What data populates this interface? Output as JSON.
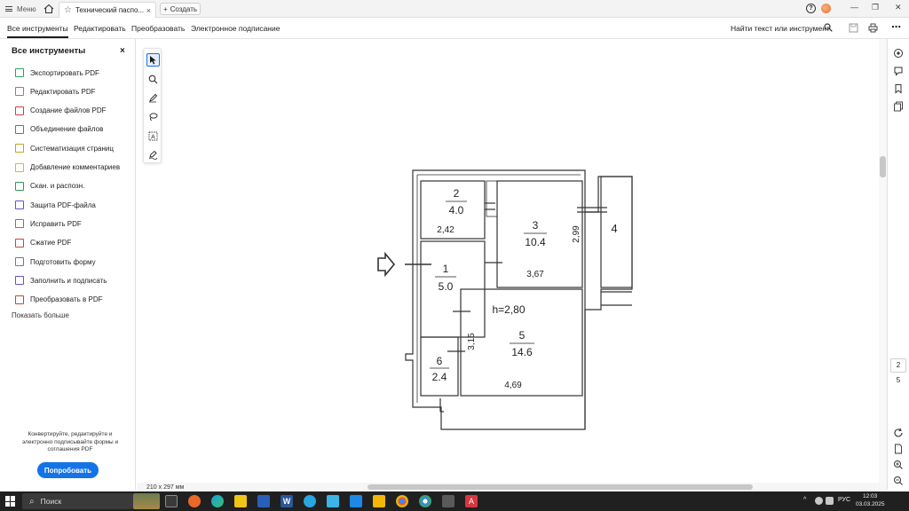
{
  "titlebar": {
    "menu_label": "Меню",
    "tab_title": "Технический паспо...",
    "tab_close": "×",
    "new_tab_label": "Создать",
    "win_min": "—",
    "win_restore": "❐",
    "win_close": "✕"
  },
  "toolbar": {
    "tabs": [
      "Все инструменты",
      "Редактировать",
      "Преобразовать",
      "Электронное подписание"
    ],
    "find_label": "Найти текст или инструмент"
  },
  "leftpanel": {
    "title": "Все инструменты",
    "close": "×",
    "tools": [
      {
        "label": "Экспортировать PDF",
        "color": "#2f9e6b"
      },
      {
        "label": "Редактировать PDF",
        "color": "#e05a6b"
      },
      {
        "label": "Создание файлов PDF",
        "color": "#d43d3d"
      },
      {
        "label": "Объединение файлов",
        "color": "#7b5bd6"
      },
      {
        "label": "Систематизация страниц",
        "color": "#c7a21e"
      },
      {
        "label": "Добавление комментариев",
        "color": "#e9b21a"
      },
      {
        "label": "Скан. и распозн.",
        "color": "#2e9a5a"
      },
      {
        "label": "Защита PDF-файла",
        "color": "#6a4fd3"
      },
      {
        "label": "Исправить PDF",
        "color": "#d44a6b"
      },
      {
        "label": "Сжатие PDF",
        "color": "#d43d3d"
      },
      {
        "label": "Подготовить форму",
        "color": "#8f5bd6"
      },
      {
        "label": "Заполнить и подписать",
        "color": "#6a4fd3"
      },
      {
        "label": "Преобразовать в PDF",
        "color": "#d43d3d"
      }
    ],
    "show_more": "Показать больше",
    "promo_text": "Конвертируйте, редактируйте и электронно подписывайте формы и соглашения PDF",
    "try_button": "Попробовать"
  },
  "document": {
    "page_size": "210 x 297 мм",
    "floorplan": {
      "rooms": [
        {
          "num": "2",
          "area": "4.0"
        },
        {
          "num": "3",
          "area": "10.4"
        },
        {
          "num": "4",
          "area": ""
        },
        {
          "num": "1",
          "area": "5.0"
        },
        {
          "num": "5",
          "area": "14.6"
        },
        {
          "num": "6",
          "area": "2.4"
        }
      ],
      "dims": {
        "d1": "2,42",
        "d2": "2,99",
        "d3": "3,67",
        "d4": "3,15",
        "d5": "4,69"
      },
      "height": "h=2,80"
    }
  },
  "rightrail": {
    "current_page": "2",
    "total_pages": "5"
  },
  "taskbar": {
    "search_label": "Поиск",
    "language": "РУС",
    "time": "12:03",
    "date": "03.03.2025"
  }
}
